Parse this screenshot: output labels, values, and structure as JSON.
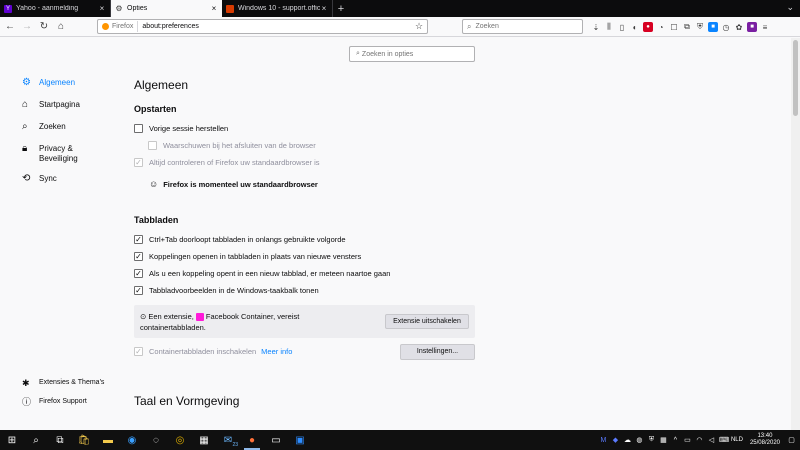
{
  "tabs": [
    {
      "title": "Yahoo - aanmelding",
      "favicon_color": "#6001d2",
      "favicon_glyph": "Y"
    },
    {
      "title": "Opties",
      "favicon_color": "#737373",
      "favicon_glyph": "⚙",
      "active": true
    },
    {
      "title": "Windows 10 - support.office...",
      "favicon_color": "#d83b01",
      "favicon_glyph": "■"
    }
  ],
  "new_tab_label": "+",
  "urlbar": {
    "identity": "Firefox",
    "value": "about:preferences"
  },
  "searchbar": {
    "placeholder": "Zoeken"
  },
  "toolbar_icons": [
    "library-icon",
    "sidebar-icon",
    "reader-icon",
    "pocket-icon",
    "extension-icon",
    "shield-icon",
    "container-icon",
    "screenshot-icon",
    "account-icon",
    "menu-icon"
  ],
  "pref_search": {
    "placeholder": "Zoeken in opties"
  },
  "sidebar": {
    "items": [
      {
        "label": "Algemeen",
        "icon": "gear-icon",
        "active": true
      },
      {
        "label": "Startpagina",
        "icon": "home-icon"
      },
      {
        "label": "Zoeken",
        "icon": "search-icon"
      },
      {
        "label": "Privacy & Beveiliging",
        "icon": "lock-icon"
      },
      {
        "label": "Sync",
        "icon": "sync-icon"
      }
    ],
    "bottom": [
      {
        "label": "Extensies & Thema's",
        "icon": "puzzle-icon"
      },
      {
        "label": "Firefox Support",
        "icon": "help-icon"
      }
    ]
  },
  "main": {
    "title": "Algemeen",
    "startup": {
      "heading": "Opstarten",
      "restore_session": "Vorige sessie herstellen",
      "warn_on_quit": "Waarschuwen bij het afsluiten van de browser",
      "check_default": "Altijd controleren of Firefox uw standaardbrowser is",
      "default_status": "Firefox is momenteel uw standaardbrowser"
    },
    "tabs": {
      "heading": "Tabbladen",
      "options": [
        "Ctrl+Tab doorloopt tabbladen in onlangs gebruikte volgorde",
        "Koppelingen openen in tabbladen in plaats van nieuwe vensters",
        "Als u een koppeling opent in een nieuw tabblad, er meteen naartoe gaan",
        "Tabbladvoorbeelden in de Windows-taakbalk tonen"
      ],
      "extension_notice_prefix": "Een extensie,",
      "extension_name": "Facebook Container",
      "extension_notice_suffix": ", vereist containertabbladen.",
      "disable_extension_button": "Extensie uitschakelen",
      "container_tabs": "Containertabbladen inschakelen",
      "learn_more": "Meer info",
      "settings_button": "Instellingen..."
    },
    "language_heading": "Taal en Vormgeving"
  },
  "taskbar": {
    "mail_badge": "23",
    "tray_language": "NLD",
    "time": "13:40",
    "date": "25/08/2020"
  }
}
